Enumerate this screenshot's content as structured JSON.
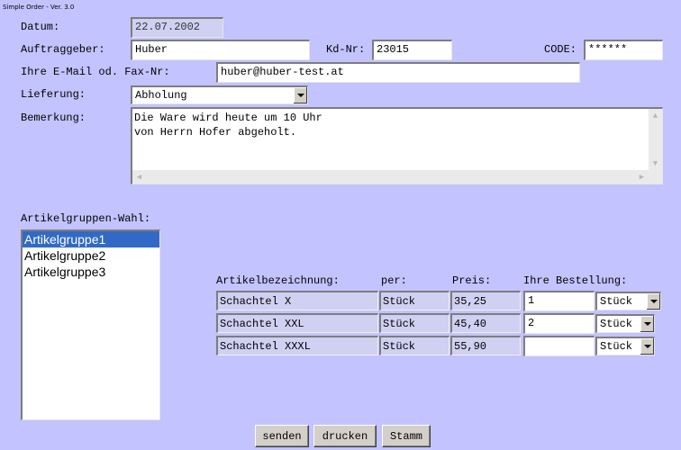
{
  "window": {
    "title": "Simple Order - Ver. 3.0"
  },
  "form": {
    "date": {
      "label": "Datum:",
      "value": "22.07.2002"
    },
    "client": {
      "label": "Auftraggeber:",
      "value": "Huber"
    },
    "customer_no": {
      "label": "Kd-Nr:",
      "value": "23015"
    },
    "code": {
      "label": "CODE:",
      "value": "******"
    },
    "email": {
      "label": "Ihre E-Mail od. Fax-Nr:",
      "value": "huber@huber-test.at"
    },
    "delivery": {
      "label": "Lieferung:",
      "value": "Abholung"
    },
    "remark": {
      "label": "Bemerkung:",
      "value": "Die Ware wird heute um 10 Uhr\nvon Herrn Hofer abgeholt."
    }
  },
  "groups": {
    "label": "Artikelgruppen-Wahl:",
    "options": [
      "Artikelgruppe1",
      "Artikelgruppe2",
      "Artikelgruppe3"
    ],
    "selected": "Artikelgruppe1"
  },
  "table": {
    "headers": [
      "Artikelbezeichnung:",
      "per:",
      "Preis:",
      "Ihre Bestellung:"
    ],
    "rows": [
      {
        "name": "Schachtel X",
        "per": "Stück",
        "price": "35,25",
        "qty": "1",
        "unit": "Stück"
      },
      {
        "name": "Schachtel XXL",
        "per": "Stück",
        "price": "45,40",
        "qty": "2",
        "unit": "Stück"
      },
      {
        "name": "Schachtel XXXL",
        "per": "Stück",
        "price": "55,90",
        "qty": "",
        "unit": "Stück"
      }
    ]
  },
  "buttons": {
    "send": "senden",
    "print": "drucken",
    "master": "Stamm"
  }
}
